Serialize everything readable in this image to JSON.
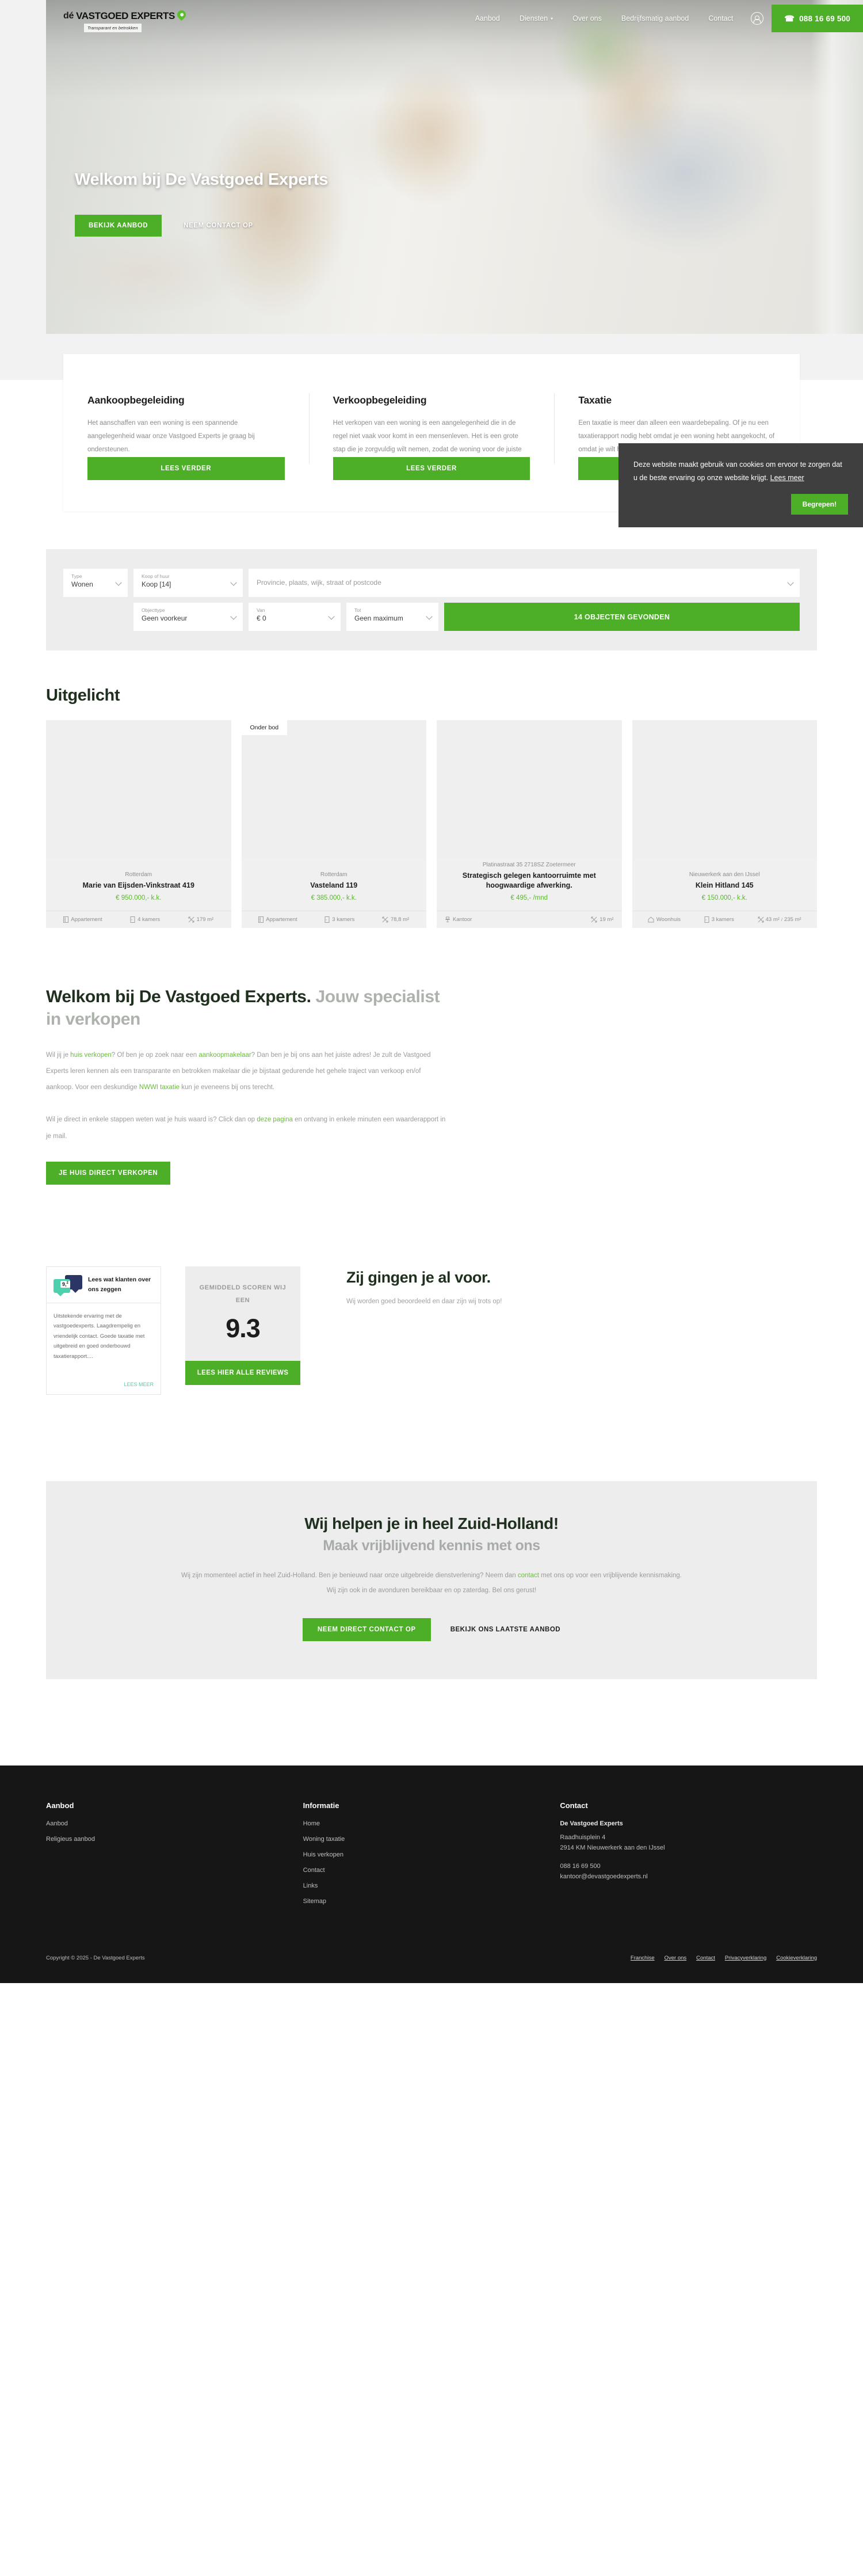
{
  "nav": {
    "logo": {
      "prefix": "dé",
      "name": "VASTGOED EXPERTS",
      "tagline": "Transparant en betrokken"
    },
    "links": [
      {
        "label": "Aanbod",
        "has_caret": false
      },
      {
        "label": "Diensten",
        "has_caret": true
      },
      {
        "label": "Over ons",
        "has_caret": false
      },
      {
        "label": "Bedrijfsmatig aanbod",
        "has_caret": false
      },
      {
        "label": "Contact",
        "has_caret": false
      }
    ],
    "phone": "088 16 69 500"
  },
  "hero": {
    "title": "Welkom bij De Vastgoed Experts",
    "primary_button": "BEKIJK AANBOD",
    "secondary_button": "NEEM CONTACT OP"
  },
  "services": [
    {
      "title": "Aankoopbegeleiding",
      "text": "Het aanschaffen van een woning is een spannende aangelegenheid waar onze Vastgoed Experts je graag bij ondersteunen.",
      "button": "LEES VERDER"
    },
    {
      "title": "Verkoopbegeleiding",
      "text": "Het verkopen van een woning is een aangelegenheid die in de regel niet vaak voor komt in een mensenleven. Het is een grote stap die je zorgvuldig wilt nemen, zodat de woning voor de juiste prijs en onder de juiste voorwaarden wordt verkocht.",
      "button": "LEES VERDER"
    },
    {
      "title": "Taxatie",
      "text": "Een taxatie is meer dan alleen een waardebepaling. Of je nu een taxatierapport nodig hebt omdat je een woning hebt aangekocht, of omdat je wilt herfinancieren ten behoeve van een verbouwing of je simpelweg zekerheid wilt over de waarde van je woning.",
      "button": "LEES VERDER"
    }
  ],
  "cookie": {
    "text_before": "Deze website maakt gebruik van cookies om ervoor te zorgen dat u de beste ervaring op onze website krijgt.",
    "link": "Lees meer",
    "button": "Begrepen!"
  },
  "search": {
    "type_label": "Type",
    "type_value": "Wonen",
    "koop_label": "Koop of huur",
    "koop_value": "Koop [14]",
    "location_placeholder": "Provincie, plaats, wijk, straat of postcode",
    "objecttype_label": "Objecttype",
    "objecttype_value": "Geen voorkeur",
    "van_label": "Van",
    "van_value": "€ 0",
    "tot_label": "Tot",
    "tot_value": "Geen maximum",
    "results_button": "14 OBJECTEN GEVONDEN"
  },
  "featured": {
    "heading": "Uitgelicht",
    "properties": [
      {
        "badge": "",
        "city": "Rotterdam",
        "title": "Marie van Eijsden-Vinkstraat 419",
        "price": "€ 950.000,- k.k.",
        "feature_type": "Appartement",
        "feature_rooms": "4 kamers",
        "feature_area": "179 m²",
        "feature_area2": ""
      },
      {
        "badge": "Onder bod",
        "city": "Rotterdam",
        "title": "Vasteland 119",
        "price": "€ 385.000,- k.k.",
        "feature_type": "Appartement",
        "feature_rooms": "3 kamers",
        "feature_area": "78,8 m²",
        "feature_area2": ""
      },
      {
        "badge": "",
        "city": "Platinastraat 35 2718SZ Zoetermeer",
        "title": "Strategisch gelegen kantoorruimte met hoogwaardige afwerking.",
        "price": "€ 495,- /mnd",
        "feature_type": "Kantoor",
        "feature_rooms": "",
        "feature_area": "19 m²",
        "feature_area2": ""
      },
      {
        "badge": "",
        "city": "Nieuwerkerk aan den IJssel",
        "title": "Klein Hitland 145",
        "price": "€ 150.000,- k.k.",
        "feature_type": "Woonhuis",
        "feature_rooms": "3 kamers",
        "feature_area": "43 m²",
        "feature_area2": "235 m²"
      }
    ]
  },
  "welkom": {
    "heading_dark": "Welkom bij De Vastgoed Experts.",
    "heading_muted": " Jouw specialist in verkopen",
    "p1_a": "Wil jij je ",
    "p1_link1": "huis verkopen",
    "p1_b": "? Of ben je op zoek naar een ",
    "p1_link2": "aankoopmakelaar",
    "p1_c": "? Dan ben je bij ons aan het juiste adres! Je zult de Vastgoed Experts leren kennen als een transparante en betrokken makelaar die je bijstaat gedurende het gehele traject van verkoop en/of aankoop. Voor een deskundige ",
    "p1_link3": "NWWI taxatie",
    "p1_d": " kun je eveneens bij ons terecht.",
    "p2_a": "Wil je direct in enkele stappen weten wat je huis waard is? Click dan op ",
    "p2_link": "deze pagina",
    "p2_b": " en ontvang in enkele minuten een waarderapport in je mail.",
    "button": "JE HUIS DIRECT VERKOPEN"
  },
  "reviews": {
    "card_title": "Lees wat klanten over ons zeggen",
    "widget_score": "9,",
    "widget_score_sup": "2",
    "quote": "Uitstekende ervaring met de vastgoedexperts. Laagdrempelig en vriendelijk contact. Goede taxatie met uitgebreid en goed onderbouwd taxatierapport....",
    "read_more": "LEES MEER",
    "score_label": "GEMIDDELD SCOREN WIJ EEN",
    "score_value": "9.3",
    "score_button": "LEES HIER ALLE REVIEWS",
    "right_heading": "Zij gingen je al voor.",
    "right_sub": "Wij worden goed beoordeeld en daar zijn wij trots op!"
  },
  "cta": {
    "heading": "Wij helpen je in heel Zuid-Holland!",
    "subheading": "Maak vrijblijvend kennis met ons",
    "text_a": "Wij zijn momenteel actief in heel Zuid-Holland. Ben je benieuwd naar onze uitgebreide dienstverlening? Neem dan ",
    "text_link": "contact",
    "text_b": " met ons op voor een vrijblijvende kennismaking. Wij zijn ook in de avonduren bereikbaar en op zaterdag. Bel ons gerust!",
    "primary_button": "NEEM DIRECT CONTACT OP",
    "secondary_button": "BEKIJK ONS LAATSTE AANBOD"
  },
  "footer": {
    "col1": {
      "title": "Aanbod",
      "links": [
        "Aanbod",
        "Religieus aanbod"
      ]
    },
    "col2": {
      "title": "Informatie",
      "links": [
        "Home",
        "Woning taxatie",
        "Huis verkopen",
        "Contact",
        "Links",
        "Sitemap"
      ]
    },
    "col3": {
      "title": "Contact",
      "company": "De Vastgoed Experts",
      "address1": "Raadhuisplein 4",
      "address2": "2914 KM Nieuwerkerk aan den IJssel",
      "phone": "088 16 69 500",
      "email": "kantoor@devastgoedexperts.nl"
    },
    "copyright": "Copyright © 2025 - De Vastgoed Experts",
    "bottom_links": [
      "Franchise",
      "Over ons",
      "Contact",
      "Privacyverklaring",
      "Cookieverklaring"
    ]
  },
  "colors": {
    "green": "#4caf27",
    "green_text": "#5cb531",
    "dark": "#161616",
    "heading": "#20301f"
  }
}
